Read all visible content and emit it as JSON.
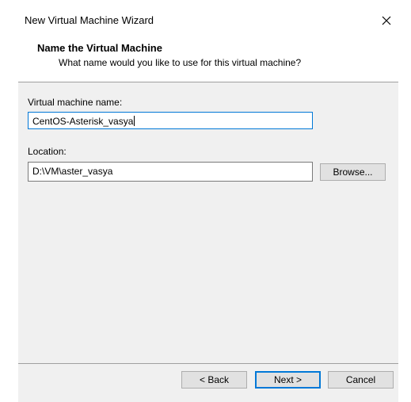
{
  "window": {
    "title": "New Virtual Machine Wizard"
  },
  "header": {
    "title": "Name the Virtual Machine",
    "subtitle": "What name would you like to use for this virtual machine?"
  },
  "form": {
    "name_label": "Virtual machine name:",
    "name_value": "CentOS-Asterisk_vasya",
    "location_label": "Location:",
    "location_value": "D:\\VM\\aster_vasya",
    "browse_label": "Browse..."
  },
  "footer": {
    "back_label": "< Back",
    "next_label": "Next >",
    "cancel_label": "Cancel"
  },
  "icons": {
    "close": "close-icon"
  },
  "colors": {
    "focus_border": "#0078d7",
    "panel_bg": "#f0f0f0",
    "button_bg": "#e1e1e1"
  }
}
